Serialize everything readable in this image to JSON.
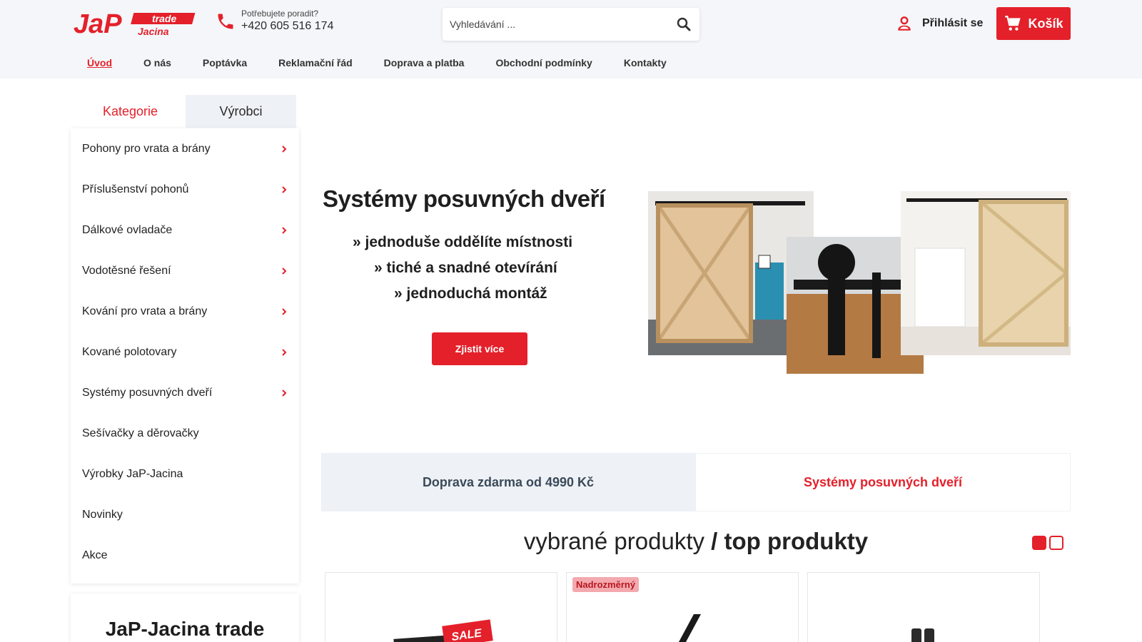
{
  "header": {
    "phone_label": "Potřebujete poradit?",
    "phone_number": "+420 605 516 174",
    "search_placeholder": "Vyhledávání ...",
    "login_label": "Přihlásit se",
    "cart_label": "Košík",
    "logo_text_main": "JaP",
    "logo_text_trade": "trade",
    "logo_text_sub": "Jacina"
  },
  "nav": {
    "items": [
      {
        "label": "Úvod",
        "active": true
      },
      {
        "label": "O nás"
      },
      {
        "label": "Poptávka"
      },
      {
        "label": "Reklamační řád"
      },
      {
        "label": "Doprava a platba"
      },
      {
        "label": "Obchodní podmínky"
      },
      {
        "label": "Kontakty"
      }
    ]
  },
  "sidebar": {
    "tabs": [
      "Kategorie",
      "Výrobci"
    ],
    "categories": [
      {
        "label": "Pohony pro vrata a brány",
        "has_children": true
      },
      {
        "label": "Příslušenství pohonů",
        "has_children": true
      },
      {
        "label": "Dálkové ovladače",
        "has_children": true
      },
      {
        "label": "Vodotěsné řešení",
        "has_children": true
      },
      {
        "label": "Kování pro vrata a brány",
        "has_children": true
      },
      {
        "label": "Kované polotovary",
        "has_children": true
      },
      {
        "label": "Systémy posuvných dveří",
        "has_children": true
      },
      {
        "label": "Sešívačky a děrovačky",
        "has_children": false
      },
      {
        "label": "Výrobky JaP-Jacina",
        "has_children": false
      },
      {
        "label": "Novinky",
        "has_children": false
      },
      {
        "label": "Akce",
        "has_children": false
      }
    ],
    "brand_title": "JaP-Jacina trade"
  },
  "banner": {
    "headline": "Systémy posuvných dveří",
    "lines": [
      "» jednoduše oddělíte místnosti",
      "» tiché a snadné otevírání",
      "» jednoduchá montáž"
    ],
    "button": "Zjistit více"
  },
  "info_tabs": [
    "Doprava zdarma od 4990 Kč",
    "Systémy posuvných dveří"
  ],
  "section": {
    "title_light": "vybrané produkty",
    "title_sep": " / ",
    "title_bold": "top produkty"
  },
  "products": [
    {
      "badge": "",
      "sale_text": "SALE"
    },
    {
      "badge": "Nadrozměrný"
    },
    {
      "badge": ""
    }
  ],
  "colors": {
    "accent": "#e4202a",
    "header_bg": "#f4f6f9",
    "tab_bg": "#eef1f5"
  }
}
